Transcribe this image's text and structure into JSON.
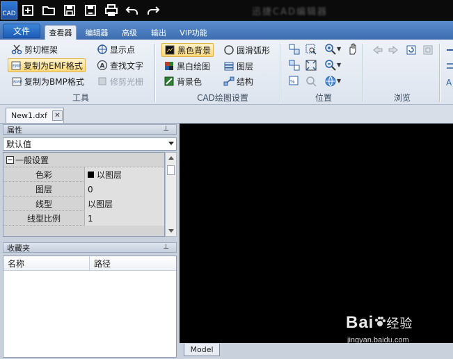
{
  "app": {
    "icon_label": "CAD",
    "title": "迅捷CAD编辑器"
  },
  "quick_access": [
    "new-icon",
    "open-icon",
    "save-icon",
    "save-as-icon",
    "print-icon",
    "undo-icon",
    "redo-icon"
  ],
  "menu": {
    "file": "文件",
    "tabs": [
      "查看器",
      "编辑器",
      "高级",
      "输出",
      "VIP功能"
    ],
    "active_tab": "查看器"
  },
  "ribbon": {
    "tools": {
      "label": "工具",
      "buttons": [
        "剪切框架",
        "复制为EMF格式",
        "复制为BMP格式",
        "显示点",
        "查找文字",
        "修剪光栅"
      ]
    },
    "cad_settings": {
      "label": "CAD绘图设置",
      "buttons": [
        "黑色背景",
        "黑白绘图",
        "背景色",
        "圆滑弧形",
        "图层",
        "结构"
      ]
    },
    "position": {
      "label": "位置"
    },
    "browse": {
      "label": "浏览"
    }
  },
  "document": {
    "tab": "New1.dxf",
    "close": "✕"
  },
  "properties": {
    "header": "属性",
    "pin": "⊥",
    "combo_value": "默认值",
    "section": "一般设置",
    "collapse": "−",
    "rows": [
      {
        "key": "色彩",
        "value": "以图层"
      },
      {
        "key": "图层",
        "value": "0"
      },
      {
        "key": "线型",
        "value": "以图层"
      },
      {
        "key": "线型比例",
        "value": "1"
      }
    ]
  },
  "favorites": {
    "header": "收藏夹",
    "pin": "⊥",
    "columns": [
      "名称",
      "路径"
    ]
  },
  "canvas": {
    "background": "#000000",
    "layout_tab": "Model"
  },
  "watermark": {
    "brand": "Bai",
    "brand_cn": "经验",
    "url": "jingyan.baidu.com"
  },
  "colors": {
    "accent": "#3d6db0",
    "highlight": "#fbd879",
    "titlebar": "#0b0b0b"
  }
}
